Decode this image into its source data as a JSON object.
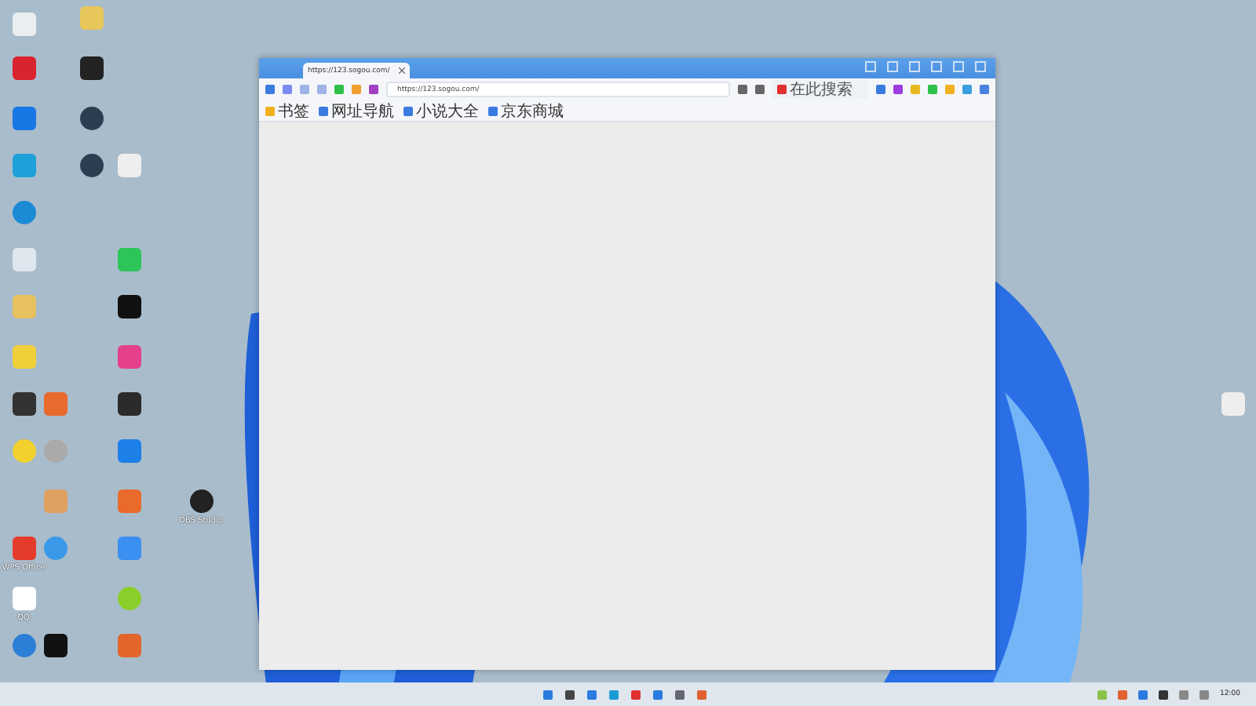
{
  "desktop_icons": [
    {
      "label": "OBS Studio"
    },
    {
      "label": "WPS Office"
    },
    {
      "label": "QQ"
    }
  ],
  "browser": {
    "tab": {
      "title": "https://123.sogou.com/",
      "selected": true
    },
    "address": "https://123.sogou.com/",
    "search": {
      "placeholder": "在此搜索"
    },
    "bookmarks": [
      {
        "label": "书签"
      },
      {
        "label": "网址导航"
      },
      {
        "label": "小说大全"
      },
      {
        "label": "京东商城"
      }
    ]
  },
  "taskbar": {
    "time": "12:00"
  }
}
